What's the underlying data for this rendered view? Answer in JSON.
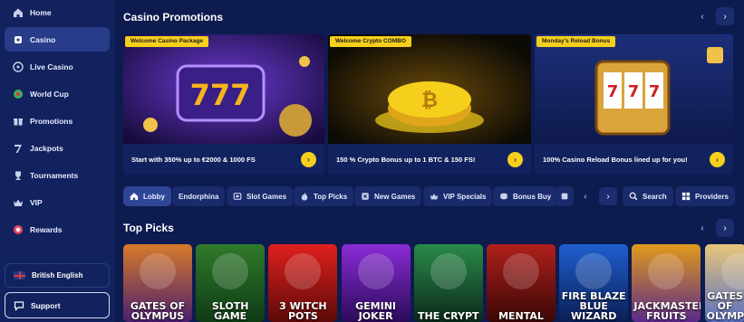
{
  "sidebar": {
    "items": [
      {
        "label": "Home",
        "icon": "home-icon"
      },
      {
        "label": "Casino",
        "icon": "casino-chip-icon"
      },
      {
        "label": "Live Casino",
        "icon": "roulette-icon"
      },
      {
        "label": "World Cup",
        "icon": "football-icon"
      },
      {
        "label": "Promotions",
        "icon": "gift-icon"
      },
      {
        "label": "Jackpots",
        "icon": "seven-icon"
      },
      {
        "label": "Tournaments",
        "icon": "trophy-icon"
      },
      {
        "label": "VIP",
        "icon": "crown-icon"
      },
      {
        "label": "Rewards",
        "icon": "reward-icon"
      }
    ],
    "active_index": 1,
    "language": "British English",
    "support": "Support"
  },
  "promotions": {
    "title": "Casino Promotions",
    "cards": [
      {
        "tag": "Welcome Casino Package",
        "text": "Start with 350% up to €2000 & 1000 FS",
        "art": "slot-777"
      },
      {
        "tag": "Welcome Crypto COMBO",
        "text": "150 % Crypto Bonus up to 1 BTC & 150 FS!",
        "art": "bitcoin"
      },
      {
        "tag": "Monday's Reload Bonus",
        "text": "100% Casino Reload Bonus lined up for you!",
        "art": "slot-machine"
      }
    ]
  },
  "categories": {
    "items": [
      {
        "label": "Lobby",
        "icon": "home-icon"
      },
      {
        "label": "Endorphina",
        "icon": ""
      },
      {
        "label": "Slot Games",
        "icon": "slot-icon"
      },
      {
        "label": "Top Picks",
        "icon": "fire-icon"
      },
      {
        "label": "New Games",
        "icon": "new-icon"
      },
      {
        "label": "VIP Specials",
        "icon": "crown-icon"
      },
      {
        "label": "Bonus Buy",
        "icon": "coins-icon"
      }
    ],
    "search": "Search",
    "providers": "Providers"
  },
  "top_picks": {
    "title": "Top Picks",
    "games": [
      {
        "name": "GATES OF OLYMPUS",
        "colors": [
          "#d77a2a",
          "#4b1f6e"
        ]
      },
      {
        "name": "SLOTH GAME",
        "colors": [
          "#2f7a2a",
          "#0f3b16"
        ]
      },
      {
        "name": "3 WITCH POTS",
        "colors": [
          "#e0201d",
          "#5d0a0a"
        ]
      },
      {
        "name": "GEMINI JOKER",
        "colors": [
          "#8a2bd6",
          "#2b0b59"
        ]
      },
      {
        "name": "THE CRYPT",
        "colors": [
          "#2a8a4a",
          "#0b2a1a"
        ]
      },
      {
        "name": "MENTAL",
        "colors": [
          "#b0201b",
          "#3a0707"
        ]
      },
      {
        "name": "FIRE BLAZE BLUE WIZARD",
        "colors": [
          "#1f5fd0",
          "#0b1f55"
        ]
      },
      {
        "name": "JACKMASTER FRUITS",
        "colors": [
          "#e29a1b",
          "#5b2a8a"
        ]
      },
      {
        "name": "GATES OF OLYMPUS",
        "colors": [
          "#e8c67a",
          "#5a6fc0"
        ]
      }
    ]
  },
  "colors": {
    "accent": "#f6cf1d",
    "sidebar": "#12225e",
    "background": "#0d1b4f"
  }
}
